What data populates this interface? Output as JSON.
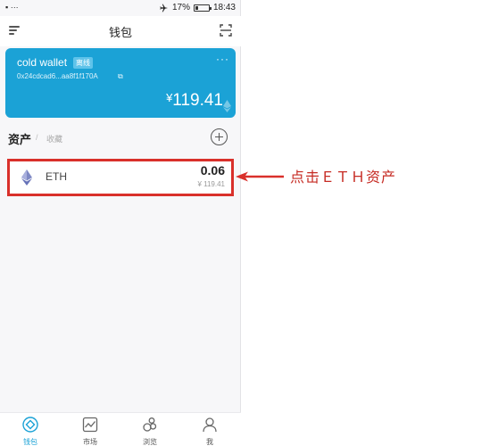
{
  "status_bar": {
    "left": "▪ ···",
    "battery": "17%",
    "time": "18:43"
  },
  "nav": {
    "title": "钱包",
    "menu_icon": "menu-icon",
    "scan_icon": "scan-icon"
  },
  "wallet": {
    "name": "cold wallet",
    "badge": "离线",
    "address": "0x24cdcad6...aa8f1f170A",
    "currency": "¥",
    "balance": "119.41",
    "more": "···",
    "card_color": "#1ba2d6"
  },
  "assets": {
    "tab_assets": "资产",
    "separator": "/",
    "tab_collectibles": "收藏"
  },
  "eth_row": {
    "symbol": "ETH",
    "amount": "0.06",
    "value": "¥ 119.41",
    "highlight_color": "#d9302b"
  },
  "tab_bar": [
    {
      "label": "钱包",
      "icon": "wallet-icon",
      "active": true
    },
    {
      "label": "市场",
      "icon": "market-chart-icon",
      "active": false
    },
    {
      "label": "浏览",
      "icon": "browse-icon",
      "active": false
    },
    {
      "label": "我",
      "icon": "profile-icon",
      "active": false
    }
  ],
  "annotation": {
    "text": "点击ＥＴＨ资产",
    "color": "#c62b23"
  }
}
